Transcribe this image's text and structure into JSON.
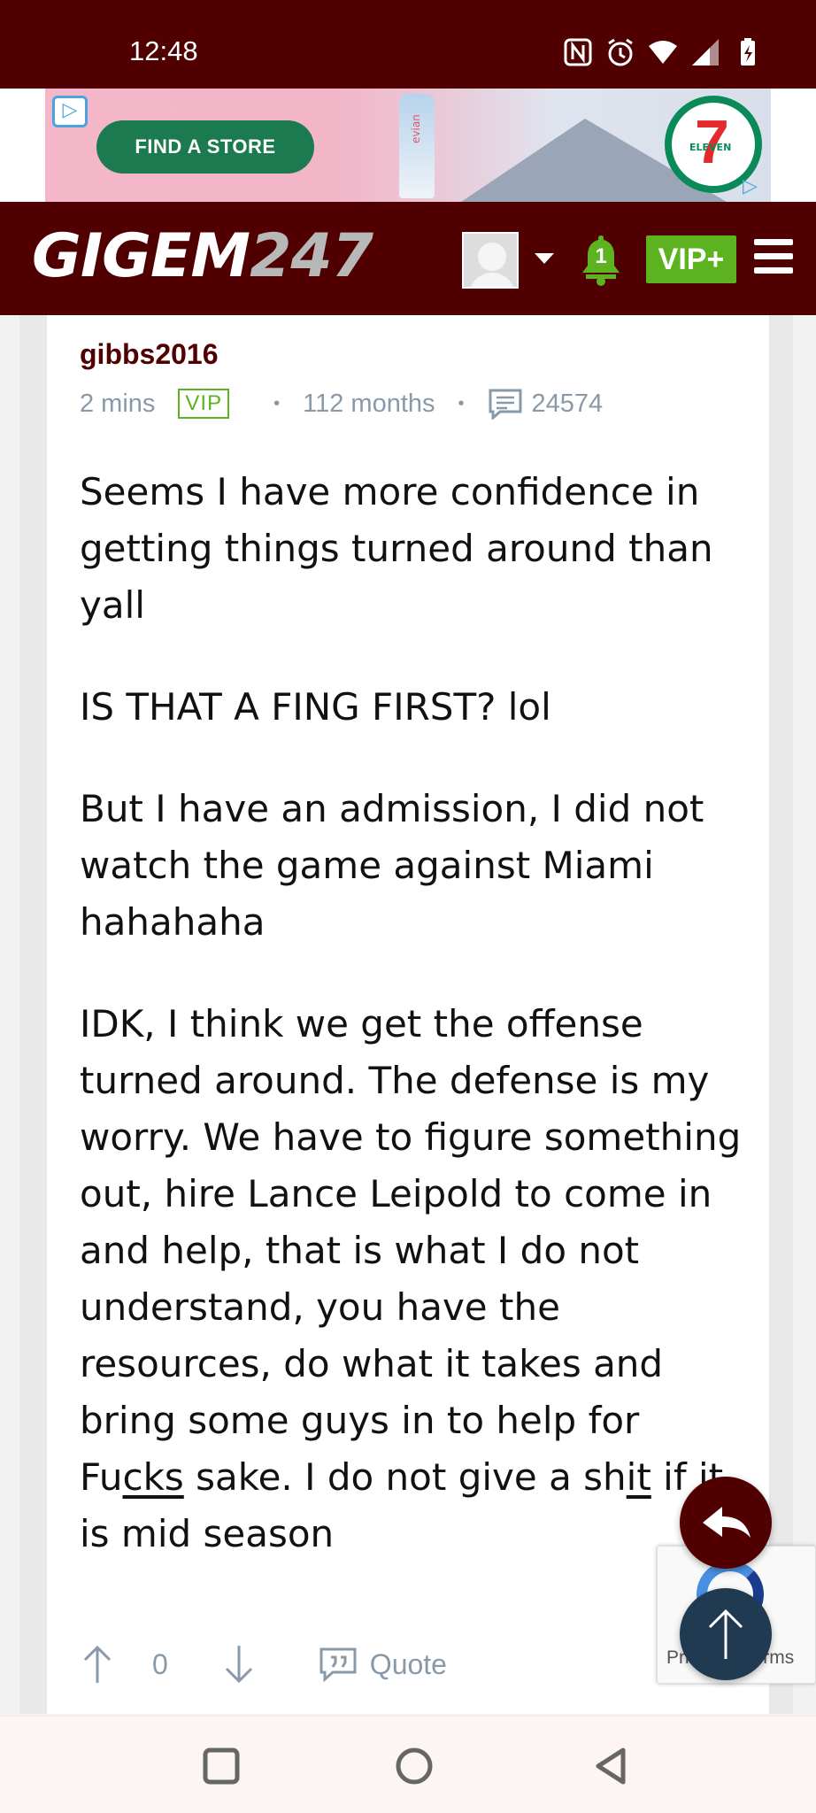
{
  "status_bar": {
    "time": "12:48",
    "icons": [
      "nfc-icon",
      "alarm-icon",
      "wifi-icon",
      "signal-icon",
      "battery-charging-icon"
    ]
  },
  "ad": {
    "button_label": "FIND A STORE",
    "brand_logo": "7-eleven-logo",
    "bottle_label": "evian",
    "logo_numeral": "7",
    "logo_text": "ELEVEN",
    "colors": {
      "background": "#f3b7c9",
      "button": "#1b7a4f"
    }
  },
  "header": {
    "logo_text": "GIGEM",
    "logo_number": "247",
    "notification_count": "1",
    "vip_label": "VIP+",
    "colors": {
      "brand": "#500000",
      "vip": "#5cb31f"
    }
  },
  "post": {
    "username": "gibbs2016",
    "time_ago": "2 mins",
    "badge": "VIP",
    "member_duration": "112 months",
    "post_count": "24574",
    "paragraphs": {
      "p1": "Seems I have more confidence in getting things turned around than yall",
      "p2": "IS THAT A FING FIRST? lol",
      "p3": "But I have an admission, I did not watch the game against Miami hahahaha",
      "p4a": "IDK, I think we get the offense turned around. The defense is my worry. We have to figure something out, hire Lance Leipold to come in and help, that is what I do not understand, you have the resources, do what it takes and bring some guys in to help for Fu",
      "p4b": "cks",
      "p4c": " sake. I do not give a sh",
      "p4d": "it",
      "p4e": " if it is mid season"
    },
    "vote_count": "0",
    "quote_label": "Quote"
  },
  "recaptcha": {
    "text": "Privacy - Terms"
  }
}
